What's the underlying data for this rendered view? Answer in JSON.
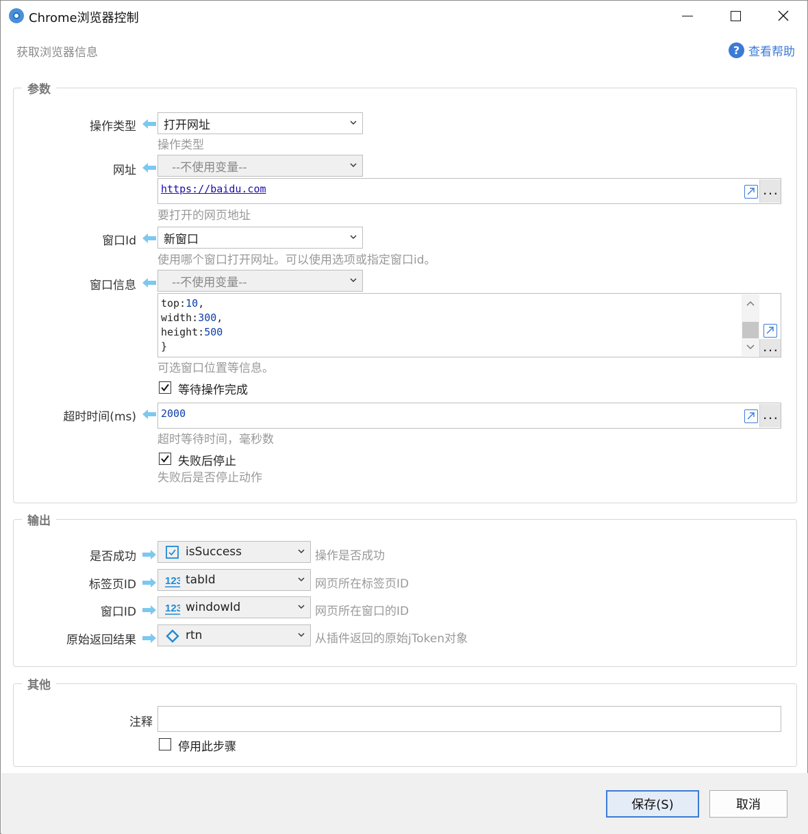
{
  "window": {
    "title": "Chrome浏览器控制",
    "subtitle": "获取浏览器信息",
    "help_label": "查看帮助"
  },
  "params": {
    "legend": "参数",
    "op_type": {
      "label": "操作类型",
      "value": "打开网址",
      "hint": "操作类型"
    },
    "url": {
      "label": "网址",
      "var": "--不使用变量--",
      "value": "https://baidu.com",
      "hint": "要打开的网页地址"
    },
    "window_id": {
      "label": "窗口Id",
      "value": "新窗口",
      "hint": "使用哪个窗口打开网址。可以使用选项或指定窗口id。"
    },
    "window_info": {
      "label": "窗口信息",
      "var": "--不使用变量--",
      "lines": [
        {
          "key": "top:",
          "num": "10",
          "tail": ","
        },
        {
          "key": "width:",
          "num": "300",
          "tail": ","
        },
        {
          "key": "height:",
          "num": "500",
          "tail": ""
        },
        {
          "key": "}",
          "num": "",
          "tail": ""
        }
      ],
      "hint": "可选窗口位置等信息。"
    },
    "wait_done": {
      "label": "等待操作完成",
      "checked": true
    },
    "timeout": {
      "label": "超时时间(ms)",
      "value": "2000",
      "hint": "超时等待时间，毫秒数"
    },
    "stop_on_fail": {
      "label": "失败后停止",
      "checked": true,
      "hint": "失败后是否停止动作"
    }
  },
  "output": {
    "legend": "输出",
    "rows": [
      {
        "label": "是否成功",
        "icon": "checkbox-icon",
        "value": "isSuccess",
        "hint": "操作是否成功"
      },
      {
        "label": "标签页ID",
        "icon": "number-123-icon",
        "value": "tabId",
        "hint": "网页所在标签页ID"
      },
      {
        "label": "窗口ID",
        "icon": "number-123-icon",
        "value": "windowId",
        "hint": "网页所在窗口的ID"
      },
      {
        "label": "原始返回结果",
        "icon": "diamond-icon",
        "value": "rtn",
        "hint": "从插件返回的原始jToken对象"
      }
    ]
  },
  "other": {
    "legend": "其他",
    "comment_label": "注释",
    "comment_value": "",
    "disable_label": "停用此步骤",
    "disable_checked": false
  },
  "footer": {
    "save_label": "保存(S)",
    "cancel_label": "取消"
  },
  "colors": {
    "accent": "#3b7ad6",
    "arrow": "#7cc8f0"
  }
}
